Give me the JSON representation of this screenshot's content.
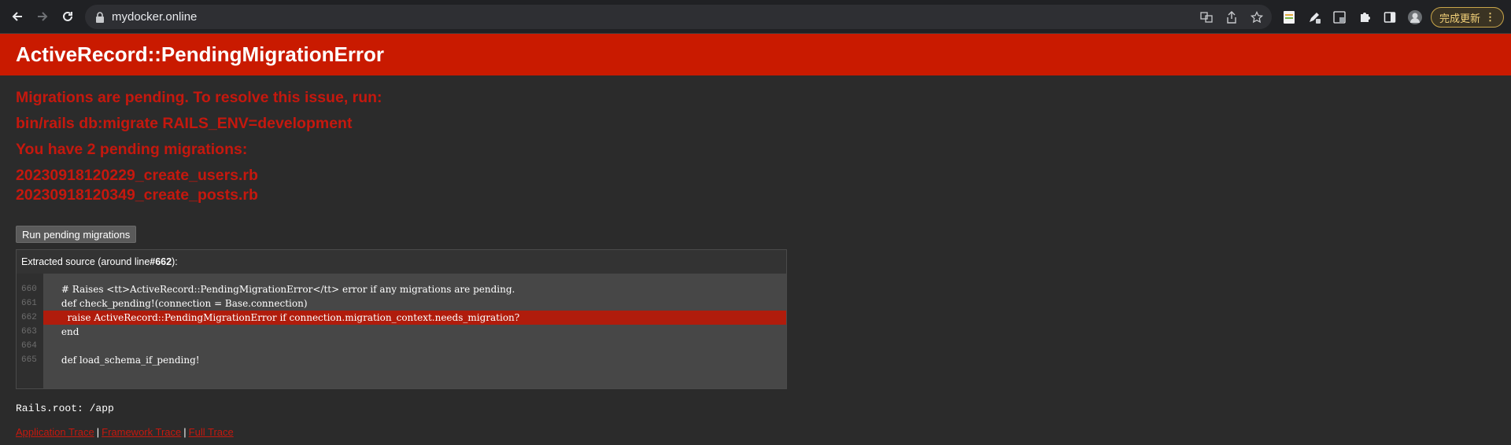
{
  "browser": {
    "url": "mydocker.online",
    "update_label": "完成更新"
  },
  "page": {
    "error_title": "ActiveRecord::PendingMigrationError",
    "message_line1": "Migrations are pending. To resolve this issue, run:",
    "command": "bin/rails db:migrate RAILS_ENV=development",
    "pending_count": "You have 2 pending migrations:",
    "migrations": [
      "20230918120229_create_users.rb",
      "20230918120349_create_posts.rb"
    ],
    "run_button_label": "Run pending migrations",
    "source_title_prefix": "Extracted source (around line ",
    "source_title_line": "#662",
    "source_title_suffix": "):",
    "source_lines": [
      {
        "num": "660",
        "code": "      # Raises <tt>ActiveRecord::PendingMigrationError</tt> error if any migrations are pending."
      },
      {
        "num": "661",
        "code": "      def check_pending!(connection = Base.connection)"
      },
      {
        "num": "662",
        "code": "        raise ActiveRecord::PendingMigrationError if connection.migration_context.needs_migration?"
      },
      {
        "num": "663",
        "code": "      end"
      },
      {
        "num": "664",
        "code": ""
      },
      {
        "num": "665",
        "code": "      def load_schema_if_pending!"
      }
    ],
    "rails_root": "Rails.root: /app",
    "trace_links": [
      "Application Trace",
      "Framework Trace",
      "Full Trace"
    ],
    "trace_separator": "|"
  },
  "colors": {
    "header_bg": "#c91a00",
    "error_text": "#c5180e",
    "highlight_line": "#b01c0c",
    "page_bg": "#2b2b2b"
  }
}
